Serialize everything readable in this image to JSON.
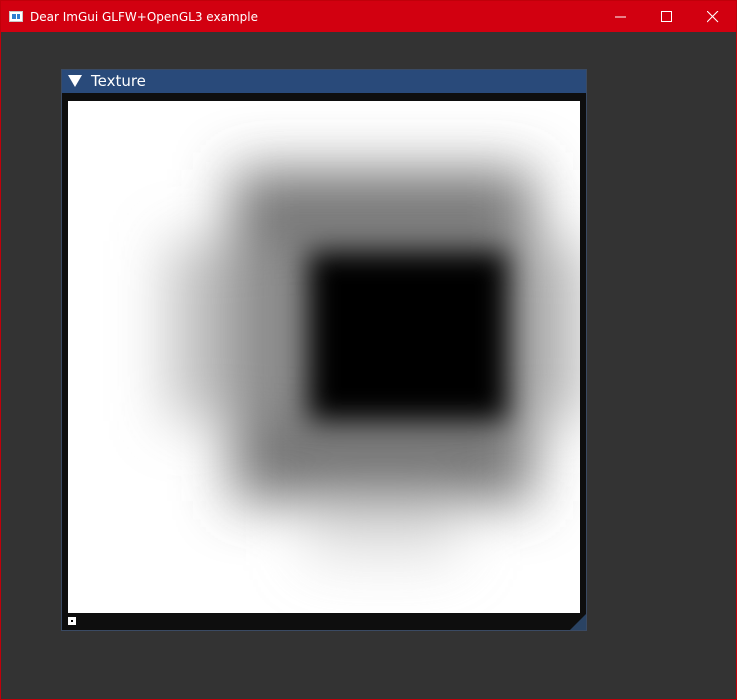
{
  "os_window": {
    "title": "Dear ImGui GLFW+OpenGL3 example",
    "icons": {
      "app": "app-icon",
      "minimize": "minimize-icon",
      "maximize": "maximize-icon",
      "close": "close-icon"
    }
  },
  "imgui_window": {
    "title": "Texture",
    "collapse_icon": "triangle-down-icon",
    "texture_description": "radial-gradient-texture"
  },
  "colors": {
    "os_titlebar": "#d20010",
    "imgui_titlebar": "#294a7a",
    "background": "#333333"
  }
}
